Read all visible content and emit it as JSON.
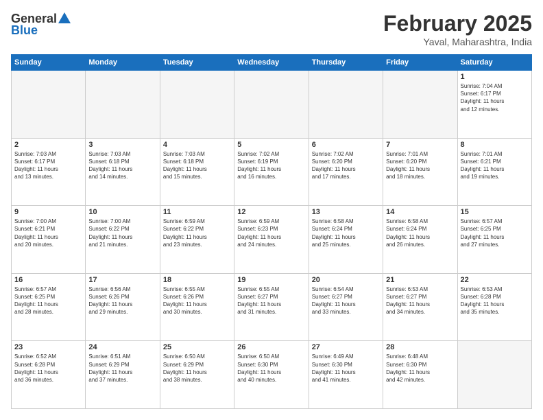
{
  "logo": {
    "line1": "General",
    "line2": "Blue"
  },
  "title": "February 2025",
  "subtitle": "Yaval, Maharashtra, India",
  "days_of_week": [
    "Sunday",
    "Monday",
    "Tuesday",
    "Wednesday",
    "Thursday",
    "Friday",
    "Saturday"
  ],
  "weeks": [
    [
      {
        "day": "",
        "info": ""
      },
      {
        "day": "",
        "info": ""
      },
      {
        "day": "",
        "info": ""
      },
      {
        "day": "",
        "info": ""
      },
      {
        "day": "",
        "info": ""
      },
      {
        "day": "",
        "info": ""
      },
      {
        "day": "1",
        "info": "Sunrise: 7:04 AM\nSunset: 6:17 PM\nDaylight: 11 hours\nand 12 minutes."
      }
    ],
    [
      {
        "day": "2",
        "info": "Sunrise: 7:03 AM\nSunset: 6:17 PM\nDaylight: 11 hours\nand 13 minutes."
      },
      {
        "day": "3",
        "info": "Sunrise: 7:03 AM\nSunset: 6:18 PM\nDaylight: 11 hours\nand 14 minutes."
      },
      {
        "day": "4",
        "info": "Sunrise: 7:03 AM\nSunset: 6:18 PM\nDaylight: 11 hours\nand 15 minutes."
      },
      {
        "day": "5",
        "info": "Sunrise: 7:02 AM\nSunset: 6:19 PM\nDaylight: 11 hours\nand 16 minutes."
      },
      {
        "day": "6",
        "info": "Sunrise: 7:02 AM\nSunset: 6:20 PM\nDaylight: 11 hours\nand 17 minutes."
      },
      {
        "day": "7",
        "info": "Sunrise: 7:01 AM\nSunset: 6:20 PM\nDaylight: 11 hours\nand 18 minutes."
      },
      {
        "day": "8",
        "info": "Sunrise: 7:01 AM\nSunset: 6:21 PM\nDaylight: 11 hours\nand 19 minutes."
      }
    ],
    [
      {
        "day": "9",
        "info": "Sunrise: 7:00 AM\nSunset: 6:21 PM\nDaylight: 11 hours\nand 20 minutes."
      },
      {
        "day": "10",
        "info": "Sunrise: 7:00 AM\nSunset: 6:22 PM\nDaylight: 11 hours\nand 21 minutes."
      },
      {
        "day": "11",
        "info": "Sunrise: 6:59 AM\nSunset: 6:22 PM\nDaylight: 11 hours\nand 23 minutes."
      },
      {
        "day": "12",
        "info": "Sunrise: 6:59 AM\nSunset: 6:23 PM\nDaylight: 11 hours\nand 24 minutes."
      },
      {
        "day": "13",
        "info": "Sunrise: 6:58 AM\nSunset: 6:24 PM\nDaylight: 11 hours\nand 25 minutes."
      },
      {
        "day": "14",
        "info": "Sunrise: 6:58 AM\nSunset: 6:24 PM\nDaylight: 11 hours\nand 26 minutes."
      },
      {
        "day": "15",
        "info": "Sunrise: 6:57 AM\nSunset: 6:25 PM\nDaylight: 11 hours\nand 27 minutes."
      }
    ],
    [
      {
        "day": "16",
        "info": "Sunrise: 6:57 AM\nSunset: 6:25 PM\nDaylight: 11 hours\nand 28 minutes."
      },
      {
        "day": "17",
        "info": "Sunrise: 6:56 AM\nSunset: 6:26 PM\nDaylight: 11 hours\nand 29 minutes."
      },
      {
        "day": "18",
        "info": "Sunrise: 6:55 AM\nSunset: 6:26 PM\nDaylight: 11 hours\nand 30 minutes."
      },
      {
        "day": "19",
        "info": "Sunrise: 6:55 AM\nSunset: 6:27 PM\nDaylight: 11 hours\nand 31 minutes."
      },
      {
        "day": "20",
        "info": "Sunrise: 6:54 AM\nSunset: 6:27 PM\nDaylight: 11 hours\nand 33 minutes."
      },
      {
        "day": "21",
        "info": "Sunrise: 6:53 AM\nSunset: 6:27 PM\nDaylight: 11 hours\nand 34 minutes."
      },
      {
        "day": "22",
        "info": "Sunrise: 6:53 AM\nSunset: 6:28 PM\nDaylight: 11 hours\nand 35 minutes."
      }
    ],
    [
      {
        "day": "23",
        "info": "Sunrise: 6:52 AM\nSunset: 6:28 PM\nDaylight: 11 hours\nand 36 minutes."
      },
      {
        "day": "24",
        "info": "Sunrise: 6:51 AM\nSunset: 6:29 PM\nDaylight: 11 hours\nand 37 minutes."
      },
      {
        "day": "25",
        "info": "Sunrise: 6:50 AM\nSunset: 6:29 PM\nDaylight: 11 hours\nand 38 minutes."
      },
      {
        "day": "26",
        "info": "Sunrise: 6:50 AM\nSunset: 6:30 PM\nDaylight: 11 hours\nand 40 minutes."
      },
      {
        "day": "27",
        "info": "Sunrise: 6:49 AM\nSunset: 6:30 PM\nDaylight: 11 hours\nand 41 minutes."
      },
      {
        "day": "28",
        "info": "Sunrise: 6:48 AM\nSunset: 6:30 PM\nDaylight: 11 hours\nand 42 minutes."
      },
      {
        "day": "",
        "info": ""
      }
    ]
  ]
}
